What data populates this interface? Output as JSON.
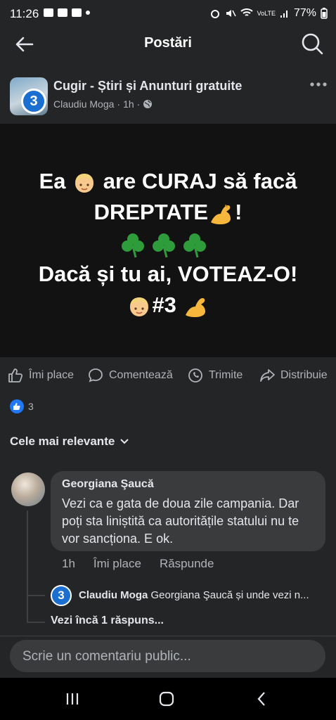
{
  "status_bar": {
    "time": "11:26",
    "battery": "77%",
    "network": "VoLTE"
  },
  "header": {
    "title": "Postări"
  },
  "post": {
    "group_name": "Cugir - Știri și Anunturi gratuite",
    "author": "Claudiu Moga",
    "time": "1h",
    "separator": "·",
    "badge": "3",
    "image_text": {
      "line1_a": "Ea",
      "line1_b": "are CURAJ să facă",
      "line2": "DREPTATE",
      "line2_end": "!",
      "line4": "Dacă și tu ai, VOTEAZ-O!",
      "line5": "#3"
    }
  },
  "actions": {
    "like": "Îmi place",
    "comment": "Comentează",
    "send": "Trimite",
    "share": "Distribuie"
  },
  "reactions": {
    "count": "3"
  },
  "sort": {
    "label": "Cele mai relevante"
  },
  "comment": {
    "author": "Georgiana Şaucă",
    "text": "Vezi ca e gata de doua zile campania. Dar poți sta liniștită ca autoritățile statului nu te vor sancționa. E ok.",
    "time": "1h",
    "like": "Îmi place",
    "reply": "Răspunde"
  },
  "reply": {
    "badge": "3",
    "author": "Claudiu Moga",
    "text": "Georgiana Şaucă și unde vezi n..."
  },
  "more_replies": "Vezi încă 1 răspuns...",
  "composer": {
    "placeholder": "Scrie un comentariu public..."
  },
  "colors": {
    "background": "#242526",
    "bubble": "#3a3b3c",
    "accent": "#2078f4",
    "muted": "#b0b3b8"
  }
}
